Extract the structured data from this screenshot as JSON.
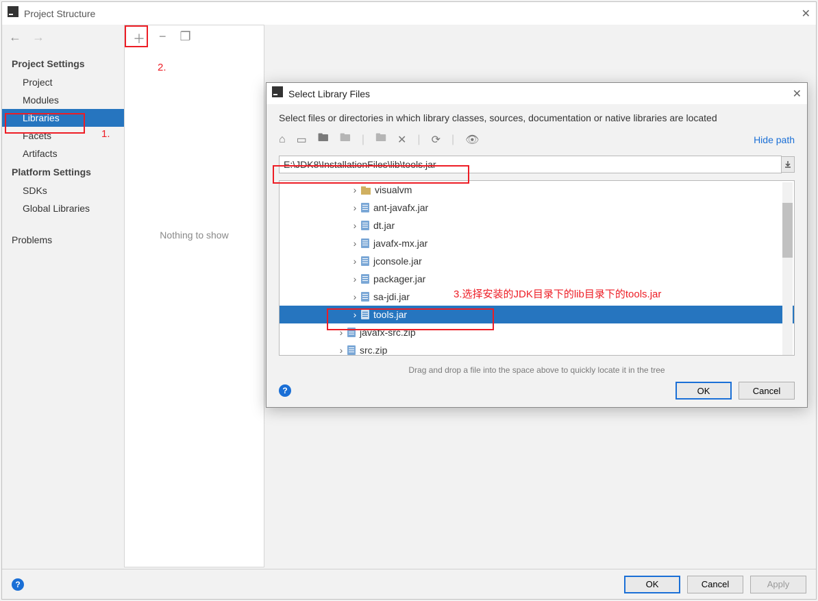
{
  "main": {
    "title": "Project Structure",
    "sections": {
      "project_settings": "Project Settings",
      "platform_settings": "Platform Settings"
    },
    "sidebar": {
      "project": "Project",
      "modules": "Modules",
      "libraries": "Libraries",
      "facets": "Facets",
      "artifacts": "Artifacts",
      "sdks": "SDKs",
      "global_libraries": "Global Libraries",
      "problems": "Problems"
    },
    "center": {
      "nothing": "Nothing to show"
    },
    "footer": {
      "ok": "OK",
      "cancel": "Cancel",
      "apply": "Apply"
    }
  },
  "dialog": {
    "title": "Select Library Files",
    "desc": "Select files or directories in which library classes, sources, documentation or native libraries are located",
    "hide_path": "Hide path",
    "path": "E:\\JDK8\\InstallationFiles\\lib\\tools.jar",
    "tree": {
      "visualvm": "visualvm",
      "ant_javafx": "ant-javafx.jar",
      "dt": "dt.jar",
      "javafx_mx": "javafx-mx.jar",
      "jconsole": "jconsole.jar",
      "packager": "packager.jar",
      "sa_jdi": "sa-jdi.jar",
      "tools": "tools.jar",
      "javafx_src": "javafx-src.zip",
      "src": "src.zip"
    },
    "hint": "Drag and drop a file into the space above to quickly locate it in the tree",
    "ok": "OK",
    "cancel": "Cancel"
  },
  "annotations": {
    "one": "1.",
    "two": "2.",
    "three": "3.选择安装的JDK目录下的lib目录下的tools.jar"
  }
}
